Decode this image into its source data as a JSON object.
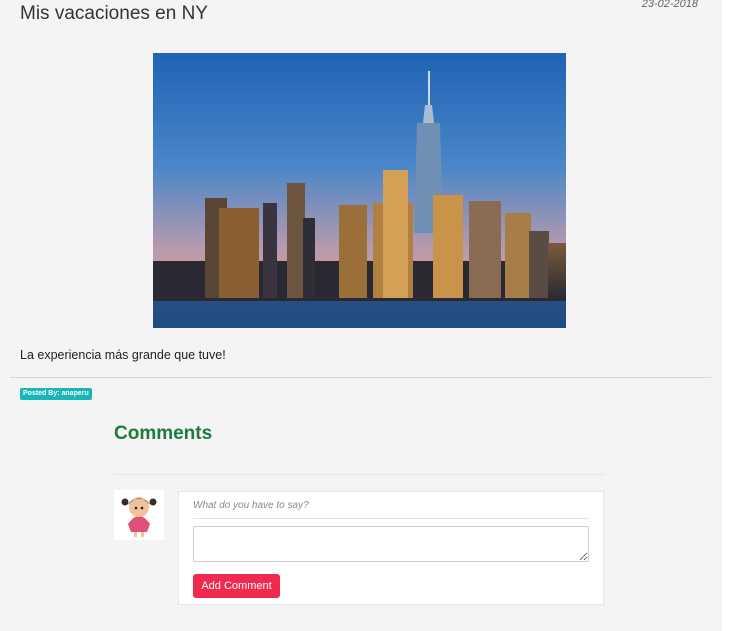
{
  "post": {
    "title": "Mis vacaciones en NY",
    "date": "23-02-2018",
    "image_alt": "New York City skyline at dusk",
    "body": "La experiencia más grande que tuve!",
    "author_badge": "Posted By: anaperu"
  },
  "comments": {
    "heading": "Comments",
    "prompt": "What do you have to say?",
    "textarea_value": "",
    "submit_label": "Add Comment"
  },
  "colors": {
    "panel_background": "#f4f4f4",
    "comments_heading": "#1d7a3c",
    "badge": "#1ab5b8",
    "button": "#f0294f"
  }
}
